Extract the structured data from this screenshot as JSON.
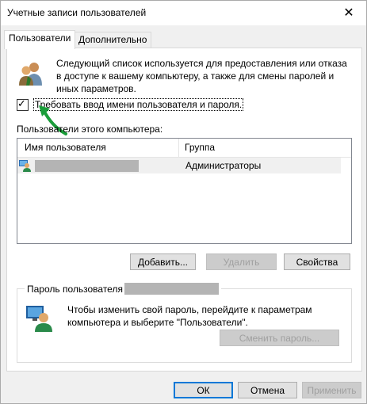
{
  "window": {
    "title": "Учетные записи пользователей",
    "close_symbol": "✕"
  },
  "tabs": [
    {
      "label": "Пользователи",
      "active": true
    },
    {
      "label": "Дополнительно",
      "active": false
    }
  ],
  "users_tab": {
    "description": "Следующий список используется для предоставления или отказа в доступе к вашему компьютеру, а также для смены паролей и иных параметров.",
    "require_login_checkbox": {
      "label": "Требовать ввод имени пользователя и пароля.",
      "checked": true
    },
    "list_label": "Пользователи этого компьютера:",
    "columns": [
      "Имя пользователя",
      "Группа"
    ],
    "rows": [
      {
        "user": "",
        "group": "Администраторы"
      }
    ],
    "buttons": {
      "add": "Добавить...",
      "remove": "Удалить",
      "properties": "Свойства"
    },
    "password_group": {
      "title": "Пароль пользователя",
      "text": "Чтобы изменить свой пароль, перейдите к параметрам компьютера и выберите \"Пользователи\".",
      "change_button": "Сменить пароль..."
    }
  },
  "dialog_buttons": {
    "ok": "ОК",
    "cancel": "Отмена",
    "apply": "Применить"
  },
  "colors": {
    "annotation_arrow": "#1a9e3a",
    "focus_blue": "#0078d7"
  },
  "icons": [
    "close-icon",
    "users-icon",
    "user-row-icon",
    "password-user-icon",
    "check-icon",
    "annotation-arrow-icon"
  ]
}
